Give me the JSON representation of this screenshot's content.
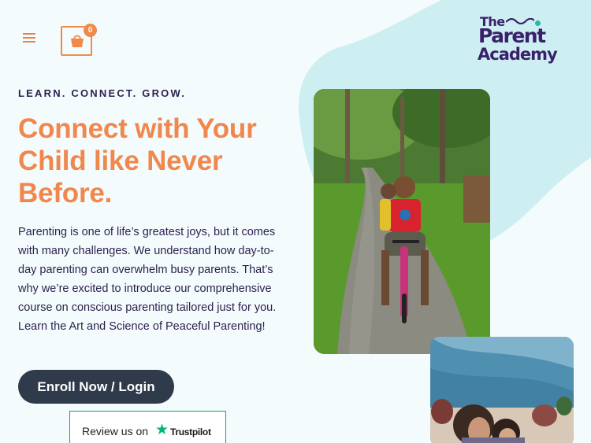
{
  "header": {
    "menu_icon": "hamburger-menu-icon",
    "cart_icon": "shopping-bag-icon",
    "cart_count": "0"
  },
  "logo": {
    "line1": "The",
    "line2": "Parent",
    "line3": "Academy"
  },
  "hero": {
    "eyebrow": "LEARN. CONNECT. GROW.",
    "headline": "Connect with Your Child like Never Before.",
    "body": "Parenting is one of life’s greatest joys, but it comes with many challenges. We understand how day-to-day parenting can overwhelm busy parents. That’s why we’re excited to introduce our comprehensive course on conscious parenting tailored just for you. Learn the Art and Science of Peaceful Parenting!",
    "cta_label": "Enroll Now / Login"
  },
  "trustpilot": {
    "label": "Review us on",
    "brand": "Trustpilot",
    "star_icon": "trustpilot-star-icon"
  },
  "colors": {
    "accent": "#f0874c",
    "dark": "#2b1f4e",
    "button": "#2f3b4b",
    "blob": "#cdeff2",
    "logo": "#3b1f6b",
    "trustpilot_green": "#00b67a"
  }
}
